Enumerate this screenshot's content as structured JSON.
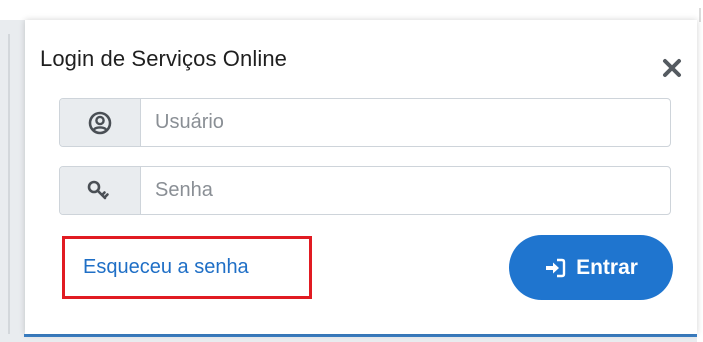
{
  "popup": {
    "title": "Login de Serviços Online",
    "close_icon": "close-icon"
  },
  "form": {
    "username": {
      "icon": "user-circle-icon",
      "placeholder": "Usuário",
      "value": ""
    },
    "password": {
      "icon": "key-icon",
      "placeholder": "Senha",
      "value": ""
    },
    "forgot_password_label": "Esqueceu a senha",
    "login_button_label": "Entrar",
    "login_button_icon": "sign-in-icon"
  },
  "colors": {
    "primary": "#1f75cf",
    "link": "#1f6fc6",
    "highlight_border": "#e11b22",
    "addon_background": "#e9ecef"
  }
}
